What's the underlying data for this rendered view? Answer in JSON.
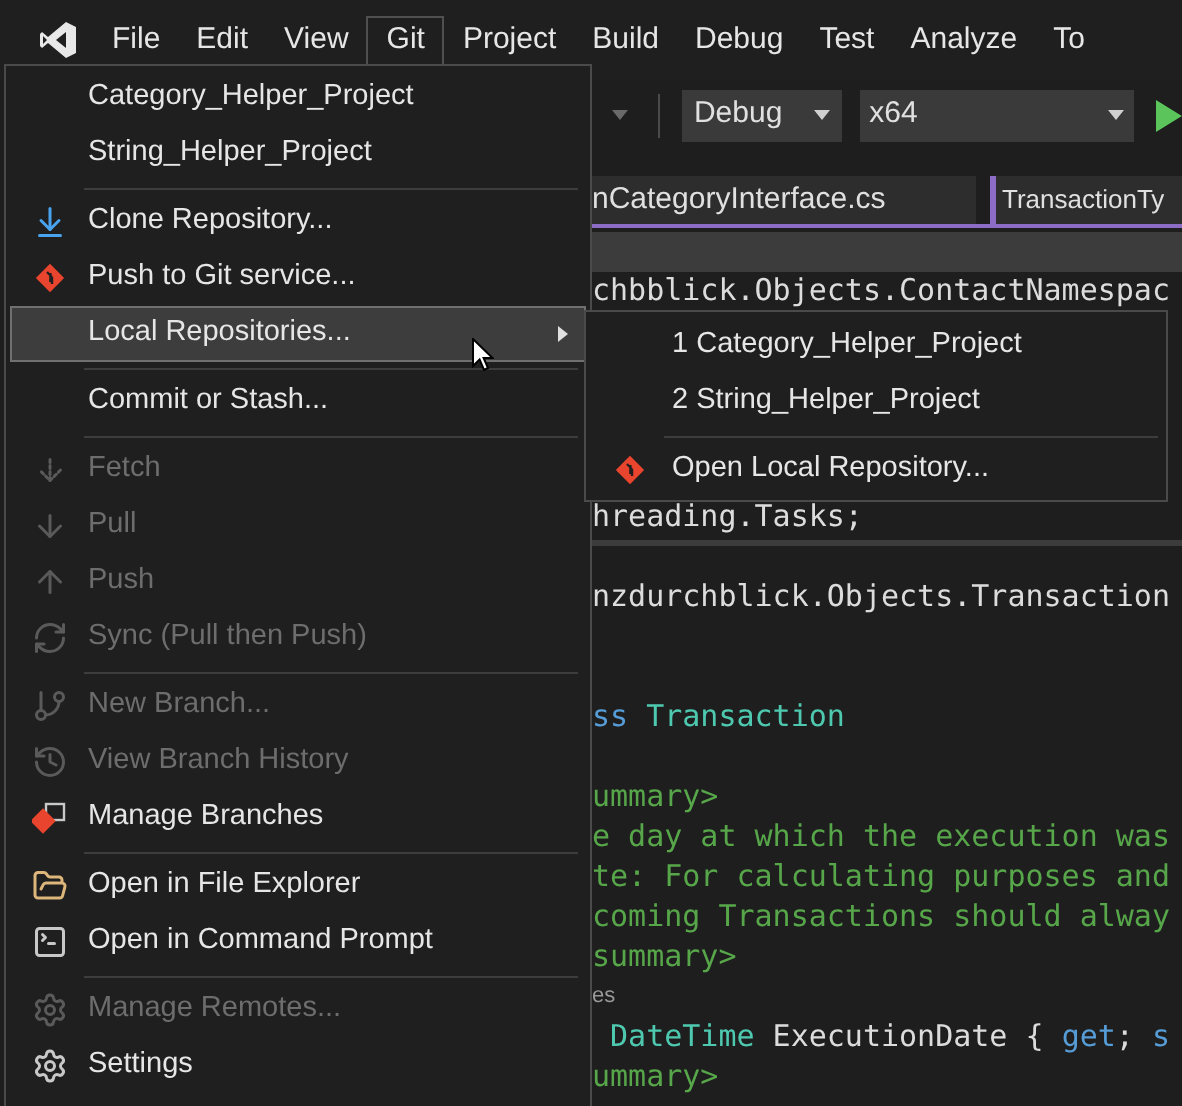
{
  "menu_bar": {
    "items": [
      {
        "label": "File",
        "selected": false
      },
      {
        "label": "Edit",
        "selected": false
      },
      {
        "label": "View",
        "selected": false
      },
      {
        "label": "Git",
        "selected": true
      },
      {
        "label": "Project",
        "selected": false
      },
      {
        "label": "Build",
        "selected": false
      },
      {
        "label": "Debug",
        "selected": false
      },
      {
        "label": "Test",
        "selected": false
      },
      {
        "label": "Analyze",
        "selected": false
      },
      {
        "label": "To",
        "selected": false
      }
    ]
  },
  "toolbar": {
    "configuration": "Debug",
    "platform": "x64"
  },
  "tabs": [
    {
      "label": "nCategoryInterface.cs"
    },
    {
      "label": "TransactionTy"
    }
  ],
  "editor": {
    "lines": [
      {
        "kind": "code",
        "tokens": [
          {
            "text": "chbblick.Objects.ContactNamespac",
            "kind": "plain"
          }
        ]
      },
      {
        "kind": "blank"
      },
      {
        "kind": "blank"
      },
      {
        "kind": "blank"
      },
      {
        "kind": "blank"
      },
      {
        "kind": "code",
        "tokens": [
          {
            "text": "hreading.Tasks;",
            "kind": "plain"
          }
        ]
      },
      {
        "kind": "rule"
      },
      {
        "kind": "code",
        "tokens": [
          {
            "text": "nzdurchblick.Objects.Transaction",
            "kind": "plain"
          }
        ]
      },
      {
        "kind": "blank"
      },
      {
        "kind": "blank"
      },
      {
        "kind": "code",
        "tokens": [
          {
            "text": "ss",
            "kind": "keyword"
          },
          {
            "text": " Transaction",
            "kind": "type"
          }
        ]
      },
      {
        "kind": "blank"
      },
      {
        "kind": "code",
        "tokens": [
          {
            "text": "ummary>",
            "kind": "comment"
          }
        ]
      },
      {
        "kind": "code",
        "tokens": [
          {
            "text": "e day at which the execution was",
            "kind": "comment"
          }
        ]
      },
      {
        "kind": "code",
        "tokens": [
          {
            "text": "te: For calculating purposes and",
            "kind": "comment"
          }
        ]
      },
      {
        "kind": "code",
        "tokens": [
          {
            "text": "coming Transactions should alway",
            "kind": "comment"
          }
        ]
      },
      {
        "kind": "code",
        "tokens": [
          {
            "text": "summary>",
            "kind": "comment"
          }
        ]
      },
      {
        "kind": "codelens",
        "tokens": [
          {
            "text": "es",
            "kind": "plain"
          }
        ]
      },
      {
        "kind": "code",
        "tokens": [
          {
            "text": " DateTime",
            "kind": "type"
          },
          {
            "text": " ExecutionDate { ",
            "kind": "plain"
          },
          {
            "text": "get",
            "kind": "keyword"
          },
          {
            "text": "; ",
            "kind": "plain"
          },
          {
            "text": "s",
            "kind": "keyword"
          }
        ]
      },
      {
        "kind": "code",
        "tokens": [
          {
            "text": "ummary>",
            "kind": "comment"
          }
        ]
      }
    ]
  },
  "git_menu": {
    "items": [
      {
        "kind": "item",
        "label": "Category_Helper_Project",
        "disabled": false,
        "selected": false
      },
      {
        "kind": "item",
        "label": "String_Helper_Project",
        "disabled": false,
        "selected": false
      },
      {
        "kind": "separator"
      },
      {
        "kind": "item",
        "label": "Clone Repository...",
        "disabled": false,
        "selected": false
      },
      {
        "kind": "item",
        "label": "Push to Git service...",
        "disabled": false,
        "selected": false
      },
      {
        "kind": "item",
        "label": "Local Repositories...",
        "disabled": false,
        "selected": true,
        "submenu": true
      },
      {
        "kind": "separator"
      },
      {
        "kind": "item",
        "label": "Commit or Stash...",
        "disabled": false,
        "selected": false
      },
      {
        "kind": "separator"
      },
      {
        "kind": "item",
        "label": "Fetch",
        "disabled": true,
        "selected": false
      },
      {
        "kind": "item",
        "label": "Pull",
        "disabled": true,
        "selected": false
      },
      {
        "kind": "item",
        "label": "Push",
        "disabled": true,
        "selected": false
      },
      {
        "kind": "item",
        "label": "Sync (Pull then Push)",
        "disabled": true,
        "selected": false
      },
      {
        "kind": "separator"
      },
      {
        "kind": "item",
        "label": "New Branch...",
        "disabled": true,
        "selected": false
      },
      {
        "kind": "item",
        "label": "View Branch History",
        "disabled": true,
        "selected": false
      },
      {
        "kind": "item",
        "label": "Manage Branches",
        "disabled": false,
        "selected": false
      },
      {
        "kind": "separator"
      },
      {
        "kind": "item",
        "label": "Open in File Explorer",
        "disabled": false,
        "selected": false
      },
      {
        "kind": "item",
        "label": "Open in Command Prompt",
        "disabled": false,
        "selected": false
      },
      {
        "kind": "separator"
      },
      {
        "kind": "item",
        "label": "Manage Remotes...",
        "disabled": true,
        "selected": false
      },
      {
        "kind": "item",
        "label": "Settings",
        "disabled": false,
        "selected": false
      }
    ]
  },
  "submenu": {
    "items": [
      {
        "kind": "item",
        "label": "1 Category_Helper_Project"
      },
      {
        "kind": "item",
        "label": "2 String_Helper_Project"
      },
      {
        "kind": "separator"
      },
      {
        "kind": "item",
        "label": "Open Local Repository..."
      }
    ]
  }
}
